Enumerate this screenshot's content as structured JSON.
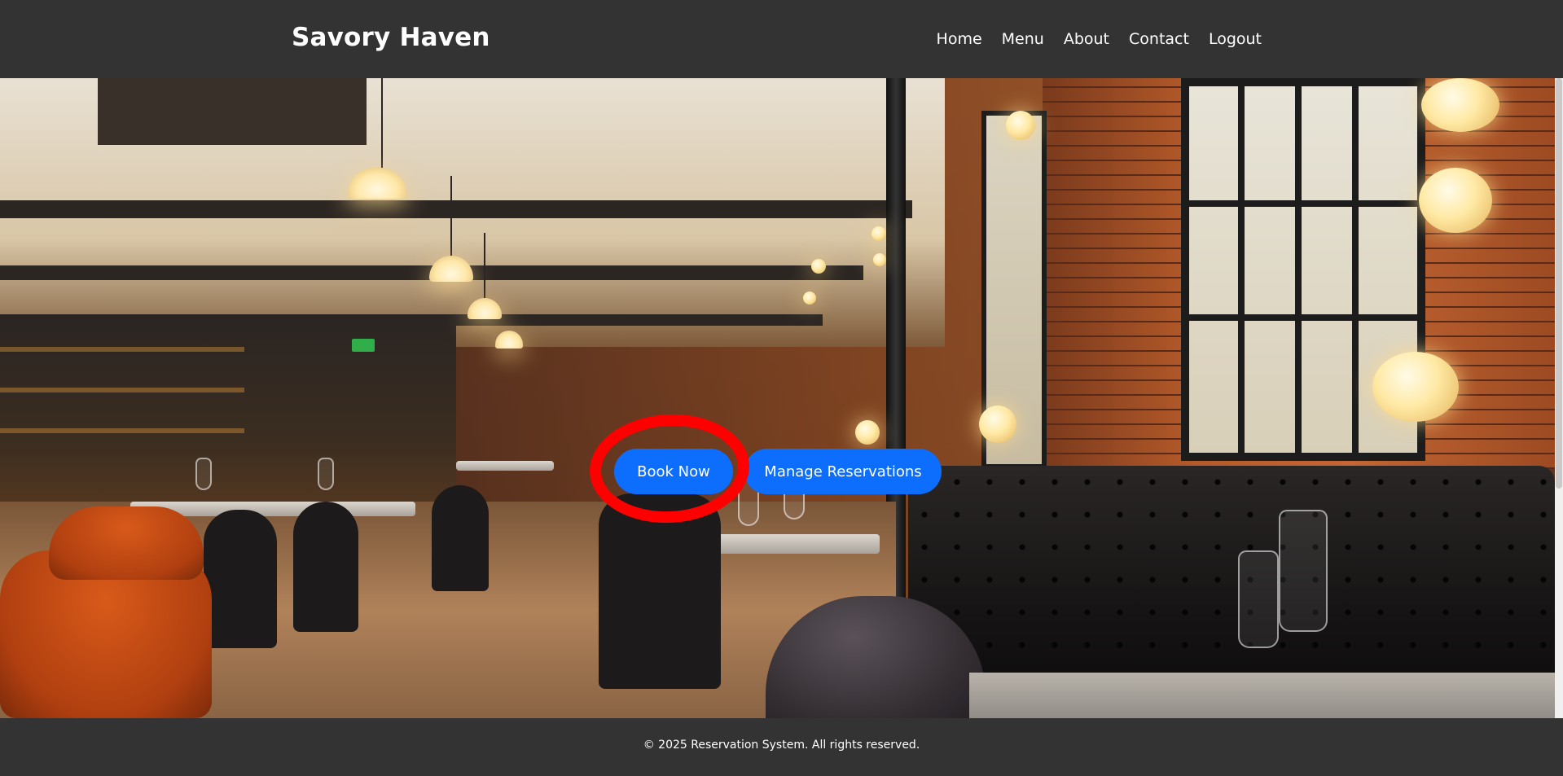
{
  "header": {
    "brand": "Savory Haven",
    "nav": [
      {
        "label": "Home"
      },
      {
        "label": "Menu"
      },
      {
        "label": "About"
      },
      {
        "label": "Contact"
      },
      {
        "label": "Logout"
      }
    ]
  },
  "hero": {
    "image_description_icon": "restaurant-interior-photo",
    "buttons": {
      "book_now": "Book Now",
      "manage_reservations": "Manage Reservations"
    },
    "annotation_icon": "red-circle-annotation"
  },
  "footer": {
    "copyright": "© 2025 Reservation System. All rights reserved."
  },
  "colors": {
    "header_bg": "#333333",
    "button_bg": "#0d6efd",
    "annotation": "#ff0000",
    "text": "#ffffff"
  }
}
